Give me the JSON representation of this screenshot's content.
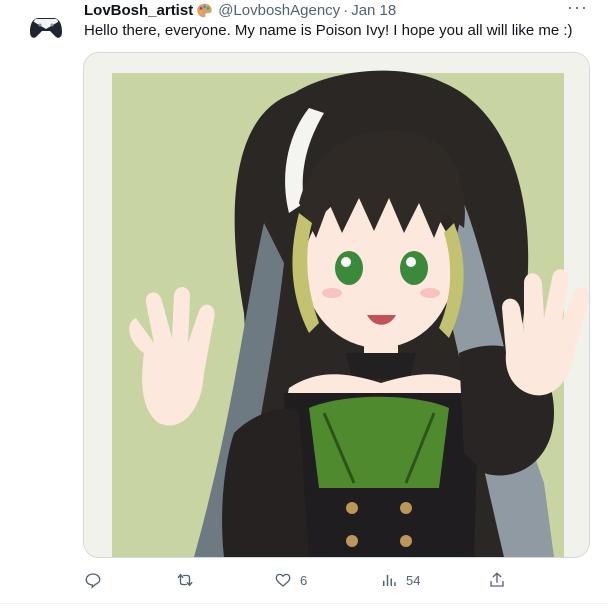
{
  "tweet": {
    "display_name": "LovBosh_artist",
    "handle": "@LovboshAgency",
    "separator": "·",
    "date": "Jan 18",
    "text": "Hello there, everyone. My name is Poison Ivy! I hope you all will like me :)",
    "more_label": "···",
    "avatar_icon": "game-controller-icon",
    "name_emoji": "artist-palette-icon"
  },
  "media": {
    "description_icon": "anime-girl-illustration"
  },
  "actions": {
    "reply_count": "",
    "retweet_count": "",
    "like_count": "6",
    "views_count": "54",
    "share_count": ""
  },
  "colors": {
    "text": "#0f1419",
    "secondary": "#536471",
    "border": "#cfd9de",
    "media_bg": "#c9d6a3"
  }
}
